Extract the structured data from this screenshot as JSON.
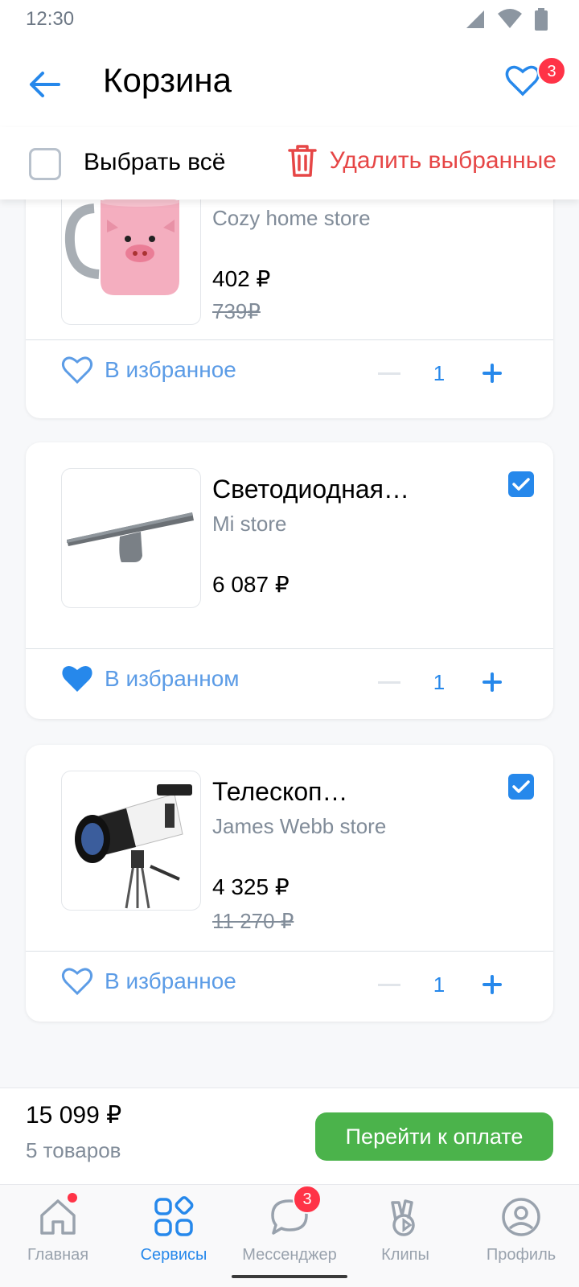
{
  "status": {
    "time": "12:30"
  },
  "header": {
    "title": "Корзина",
    "fav_count": "3"
  },
  "select_bar": {
    "select_all": "Выбрать всё",
    "delete_selected": "Удалить выбранные"
  },
  "items": [
    {
      "title": "",
      "store": "Cozy home store",
      "price": "402 ₽",
      "old_price": "739₽",
      "checked": false,
      "fav_label": "В избранное",
      "fav": false,
      "qty": "1",
      "image": "pig-mug"
    },
    {
      "title": "Светодиодная…",
      "store": "Mi store",
      "price": "6 087 ₽",
      "old_price": "",
      "checked": true,
      "fav_label": "В избранном",
      "fav": true,
      "qty": "1",
      "image": "led-monitor-lamp"
    },
    {
      "title": "Телескоп…",
      "store": "James Webb store",
      "price": "4 325 ₽",
      "old_price": "11 270 ₽",
      "checked": true,
      "fav_label": "В избранное",
      "fav": false,
      "qty": "1",
      "image": "telescope"
    }
  ],
  "checkout": {
    "total": "15 099 ₽",
    "count": "5 товаров",
    "button": "Перейти к оплате"
  },
  "tabs": [
    {
      "label": "Главная",
      "icon": "home-icon",
      "active": false,
      "dot": true
    },
    {
      "label": "Сервисы",
      "icon": "services-icon",
      "active": true
    },
    {
      "label": "Мессенджер",
      "icon": "messenger-icon",
      "active": false,
      "badge": "3"
    },
    {
      "label": "Клипы",
      "icon": "clips-icon",
      "active": false
    },
    {
      "label": "Профиль",
      "icon": "profile-icon",
      "active": false
    }
  ],
  "colors": {
    "accent": "#2688eb",
    "danger": "#e64646",
    "pay": "#4bb34b",
    "badge": "#ff3347"
  }
}
